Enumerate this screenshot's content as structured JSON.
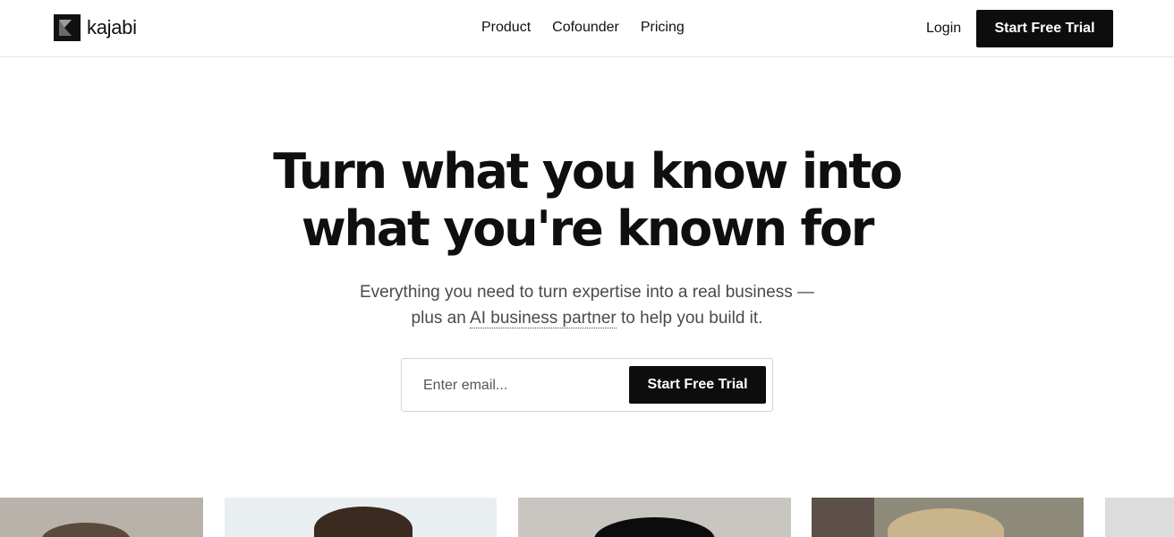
{
  "header": {
    "logo_text": "kajabi",
    "nav": [
      {
        "label": "Product"
      },
      {
        "label": "Cofounder"
      },
      {
        "label": "Pricing"
      }
    ],
    "login_label": "Login",
    "cta_label": "Start Free Trial"
  },
  "hero": {
    "title_line1": "Turn what you know into",
    "title_line2": "what you're known for",
    "subtitle_line1": "Everything you need to turn expertise into a real business —",
    "subtitle_line2_pre": "plus an ",
    "subtitle_link": "AI business partner",
    "subtitle_line2_post": " to help you build it."
  },
  "signup_form": {
    "email_placeholder": "Enter email...",
    "email_value": "",
    "cta_label": "Start Free Trial"
  },
  "colors": {
    "primary_dark": "#0d0d0d",
    "text_muted": "#4a4a4a",
    "border": "#d4d4d4"
  },
  "icons": {
    "logo": "kajabi-logo-icon"
  }
}
